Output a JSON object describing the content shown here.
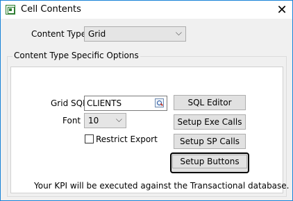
{
  "window": {
    "title": "Cell Contents",
    "close_label": "✕"
  },
  "content_type": {
    "label": "Content Type",
    "value": "Grid"
  },
  "group": {
    "title": "Content Type Specific Options"
  },
  "grid_sql": {
    "label": "Grid SQL",
    "value": "CLIENTS"
  },
  "font": {
    "label": "Font",
    "value": "10"
  },
  "restrict_export": {
    "label": "Restrict Export",
    "checked": false
  },
  "buttons": {
    "sql_editor": "SQL Editor",
    "setup_exe_calls": "Setup Exe Calls",
    "setup_sp_calls": "Setup SP Calls",
    "setup_buttons": "Setup Buttons"
  },
  "footer_note": "Your KPI will be executed against the Transactional database."
}
